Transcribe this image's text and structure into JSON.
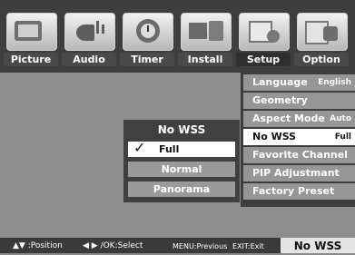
{
  "tabs": [
    {
      "label": "Picture",
      "icon": "picture-icon"
    },
    {
      "label": "Audio",
      "icon": "audio-icon"
    },
    {
      "label": "Timer",
      "icon": "timer-icon"
    },
    {
      "label": "Install",
      "icon": "install-icon"
    },
    {
      "label": "Setup",
      "icon": "setup-icon",
      "active": true
    },
    {
      "label": "Option",
      "icon": "option-icon"
    }
  ],
  "menu": {
    "items": [
      {
        "label": "Language",
        "value": "English"
      },
      {
        "label": "Geometry",
        "value": ""
      },
      {
        "label": "Aspect Mode",
        "value": "Auto"
      },
      {
        "label": "No WSS",
        "value": "Full",
        "selected": true
      },
      {
        "label": "Favorite Channel",
        "value": ""
      },
      {
        "label": "PIP Adjustmant",
        "value": ""
      },
      {
        "label": "Factory Preset",
        "value": ""
      }
    ]
  },
  "popup": {
    "title": "No WSS",
    "options": [
      {
        "label": "Full",
        "selected": true
      },
      {
        "label": "Normal"
      },
      {
        "label": "Panorama"
      }
    ],
    "check": "✓"
  },
  "footer": {
    "position": "▲▼ :Position",
    "select": "◀ ▶ /OK:Select",
    "previous": "MENU:Previous",
    "exit": "EXIT:Exit",
    "status": "No WSS"
  },
  "colors": {
    "background": "#8e8e8e",
    "bar": "#3e3e3e",
    "highlight": "#ffffff",
    "item": "#969696"
  }
}
